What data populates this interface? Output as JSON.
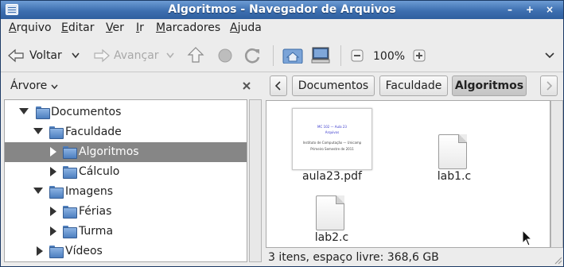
{
  "window": {
    "title": "Algoritmos - Navegador de Arquivos"
  },
  "menubar": {
    "items": [
      {
        "label": "Arquivo",
        "accel": "A",
        "rest": "rquivo"
      },
      {
        "label": "Editar",
        "accel": "E",
        "rest": "ditar"
      },
      {
        "label": "Ver",
        "accel": "V",
        "rest": "er"
      },
      {
        "label": "Ir",
        "accel": "I",
        "rest": "r"
      },
      {
        "label": "Marcadores",
        "accel": "M",
        "rest": "arcadores"
      },
      {
        "label": "Ajuda",
        "accel": "A",
        "rest": "juda"
      }
    ]
  },
  "toolbar": {
    "back_label": "Voltar",
    "forward_label": "Avançar",
    "zoom": "100%"
  },
  "sidebar": {
    "header": "Árvore",
    "tree": [
      {
        "label": "Documentos",
        "expanded": true,
        "depth": 0
      },
      {
        "label": "Faculdade",
        "expanded": true,
        "depth": 1
      },
      {
        "label": "Algoritmos",
        "expanded": false,
        "depth": 2,
        "selected": true
      },
      {
        "label": "Cálculo",
        "expanded": false,
        "depth": 2
      },
      {
        "label": "Imagens",
        "expanded": true,
        "depth": 1
      },
      {
        "label": "Férias",
        "expanded": false,
        "depth": 2
      },
      {
        "label": "Turma",
        "expanded": false,
        "depth": 2
      },
      {
        "label": "Vídeos",
        "expanded": false,
        "depth": 1
      }
    ]
  },
  "pathbar": {
    "crumbs": [
      "Documentos",
      "Faculdade",
      "Algoritmos"
    ],
    "active": "Algoritmos"
  },
  "files": [
    {
      "name": "aula23.pdf",
      "kind": "pdf"
    },
    {
      "name": "lab1.c",
      "kind": "text"
    },
    {
      "name": "lab2.c",
      "kind": "text"
    }
  ],
  "pdf_preview": {
    "line1": "MC 102 — Aula 23",
    "line2": "Arquivos",
    "line3": "Instituto de Computação — Unicamp",
    "line4": "Primeiro Semestre de 2011"
  },
  "status": {
    "text": "3 itens, espaço livre: 368,6 GB"
  },
  "colors": {
    "titlebar": "#3d6fb0",
    "selection": "#868686",
    "folder": "#4d7fbf"
  }
}
